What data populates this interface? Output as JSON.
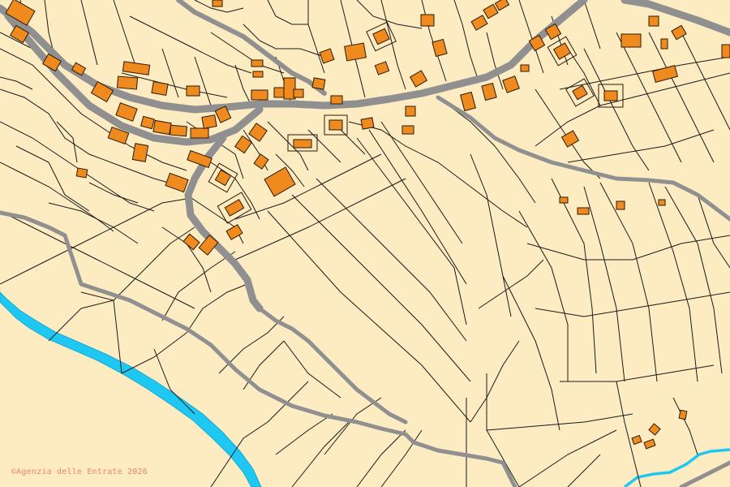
{
  "attribution": {
    "symbol": "©",
    "text": "Agenzia delle Entrate 2026"
  },
  "colors": {
    "land": "#fdebc2",
    "parcel_line": "#1a1a1a",
    "road": "#909090",
    "building_fill": "#ef8a1f",
    "building_outline": "#2b1a08",
    "water": "#1ec8f2",
    "attribution_text": "#e8866a"
  }
}
